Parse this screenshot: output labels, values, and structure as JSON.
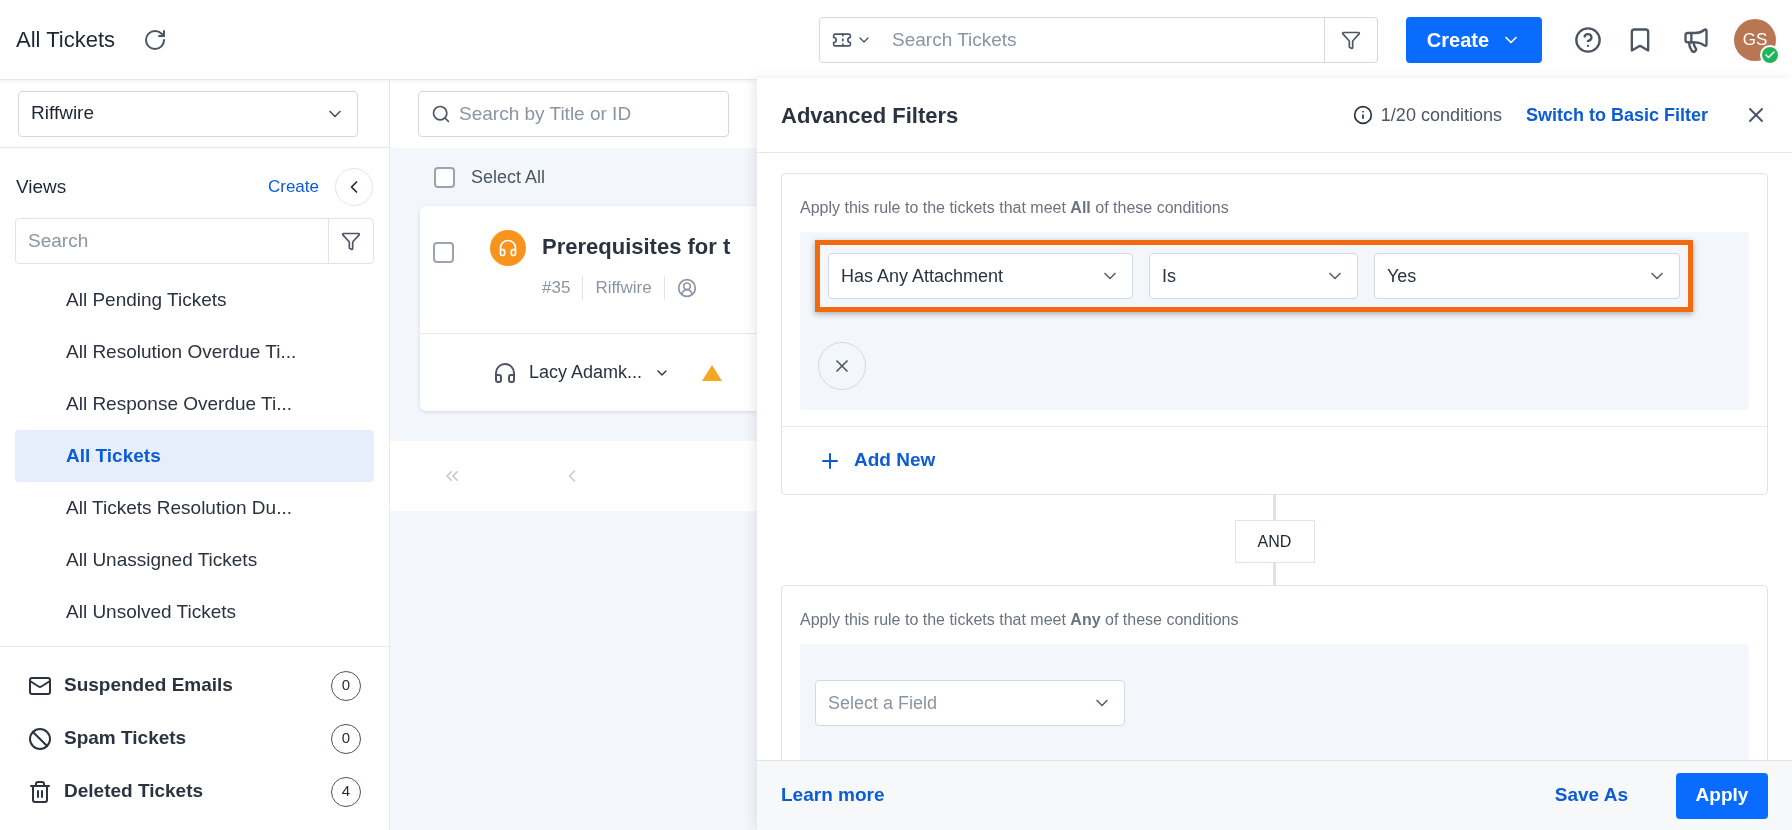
{
  "header": {
    "title": "All Tickets",
    "search_placeholder": "Search Tickets",
    "create_button": "Create",
    "avatar_initials": "GS",
    "avatar_online": true
  },
  "toolbar": {
    "workspace": "Riffwire",
    "search_placeholder": "Search by Title or ID"
  },
  "views": {
    "title": "Views",
    "create_link": "Create",
    "search_placeholder": "Search",
    "items": [
      {
        "label": "All Pending Tickets",
        "selected": false
      },
      {
        "label": "All Resolution Overdue Ti...",
        "selected": false
      },
      {
        "label": "All Response Overdue Ti...",
        "selected": false
      },
      {
        "label": "All Tickets",
        "selected": true
      },
      {
        "label": "All Tickets Resolution Du...",
        "selected": false
      },
      {
        "label": "All Unassigned Tickets",
        "selected": false
      },
      {
        "label": "All Unsolved Tickets",
        "selected": false
      }
    ]
  },
  "special_folders": [
    {
      "kind": "mail",
      "label": "Suspended Emails",
      "count": "0"
    },
    {
      "kind": "spam",
      "label": "Spam Tickets",
      "count": "0"
    },
    {
      "kind": "trash",
      "label": "Deleted Tickets",
      "count": "4"
    }
  ],
  "ticket_list": {
    "select_all": "Select All",
    "select_all_checked": false,
    "tickets": [
      {
        "title": "Prerequisites for t",
        "id": "#35",
        "workspace": "Riffwire",
        "agent": "Lacy Adamk...",
        "checked": false
      }
    ]
  },
  "filter_panel": {
    "title": "Advanced Filters",
    "conditions_count": "1/20 conditions",
    "switch_link": "Switch to Basic Filter",
    "connector": "AND",
    "groups": [
      {
        "intro": "Apply this rule to the tickets that meet **All** of these conditions",
        "add_new": "Add New",
        "conditions": [
          {
            "kind": "filled",
            "field": "Has Any Attachment",
            "operator": "Is",
            "value": "Yes",
            "highlighted": true
          }
        ]
      },
      {
        "intro": "Apply this rule to the tickets that meet **Any** of these conditions",
        "conditions": [
          {
            "kind": "empty",
            "placeholder": "Select a Field"
          }
        ]
      }
    ],
    "learn_more": "Learn more",
    "save_as": "Save As",
    "apply": "Apply"
  }
}
